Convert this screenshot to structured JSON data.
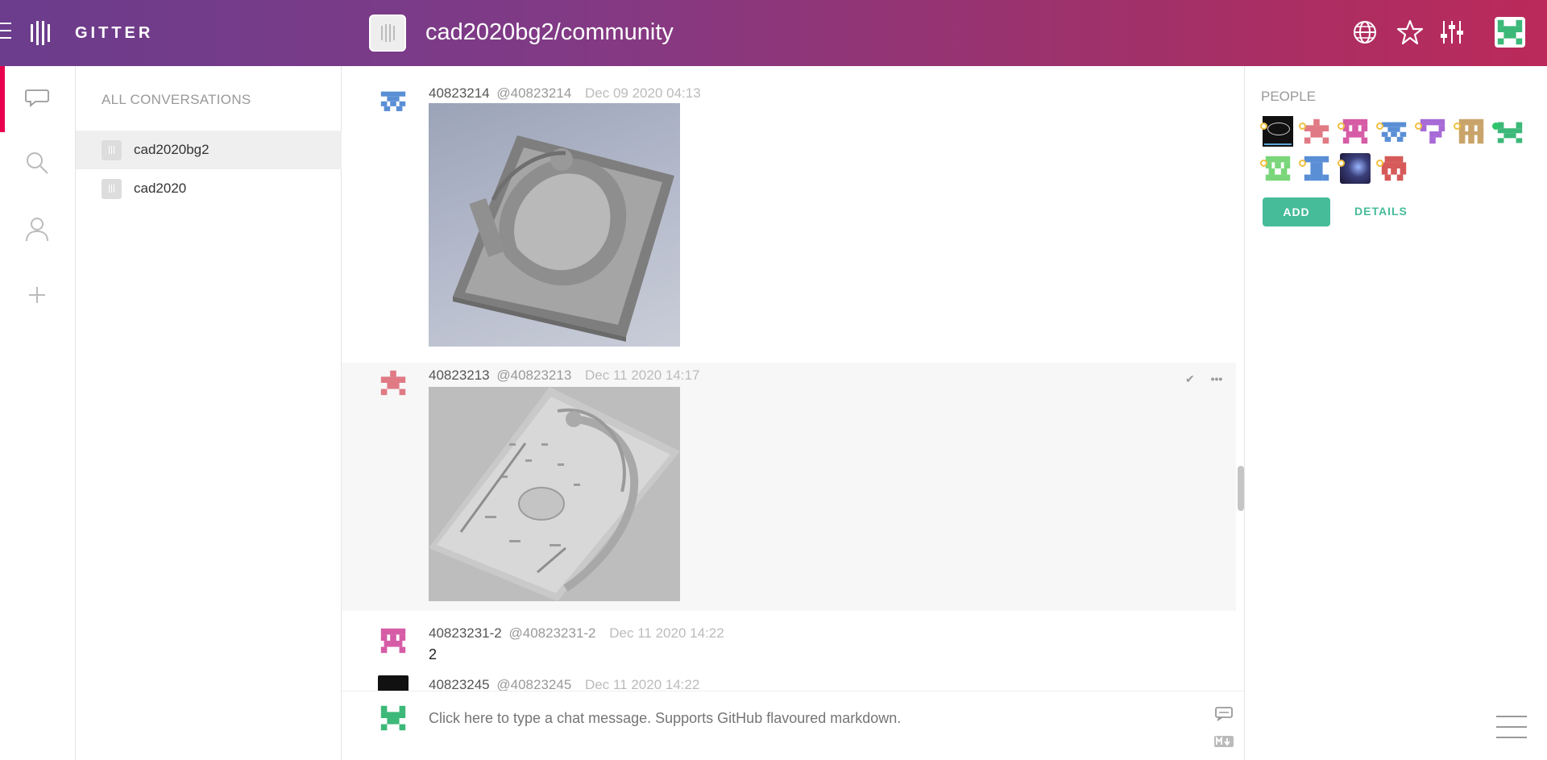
{
  "header": {
    "brand": "GITTER",
    "room_title": "cad2020bg2/community",
    "icons": [
      "menu-icon",
      "gitter-logo-icon",
      "globe-icon",
      "star-icon",
      "settings-sliders-icon",
      "user-avatar"
    ]
  },
  "rail": {
    "items": [
      "conversations-icon",
      "search-icon",
      "person-icon",
      "plus-icon"
    ]
  },
  "conversations": {
    "title": "ALL CONVERSATIONS",
    "items": [
      {
        "label": "cad2020bg2",
        "active": true
      },
      {
        "label": "cad2020",
        "active": false
      }
    ]
  },
  "messages": [
    {
      "name": "40823214",
      "handle": "@40823214",
      "time": "Dec 09 2020 04:13",
      "type": "image",
      "image_desc": "3d-model-rendering-blue"
    },
    {
      "name": "40823213",
      "handle": "@40823213",
      "time": "Dec 11 2020 14:17",
      "type": "image",
      "image_desc": "3d-model-rendering-gray"
    },
    {
      "name": "40823231-2",
      "handle": "@40823231-2",
      "time": "Dec 11 2020 14:22",
      "type": "text",
      "text": "2"
    },
    {
      "name": "40823245",
      "handle": "@40823245",
      "time": "Dec 11 2020 14:22",
      "type": "partial"
    }
  ],
  "composer": {
    "placeholder": "Click here to type a chat message. Supports GitHub flavoured markdown."
  },
  "people": {
    "title": "PEOPLE",
    "add_label": "ADD",
    "details_label": "DETAILS"
  },
  "colors": {
    "header_start": "#6b3d8c",
    "header_end": "#bb2a5a",
    "accent": "#46bc99",
    "active_rail": "#e8004f"
  }
}
